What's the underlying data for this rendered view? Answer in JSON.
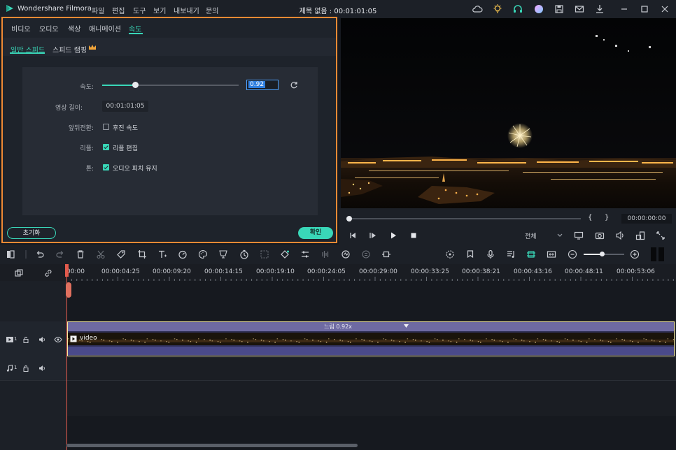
{
  "app": {
    "title": "Wondershare Filmora",
    "doc_title": "제목 없음 : 00:01:01:05"
  },
  "menu": [
    "파일",
    "편집",
    "도구",
    "보기",
    "내보내기",
    "문의"
  ],
  "panel": {
    "tabs": [
      "비디오",
      "오디오",
      "색상",
      "애니메이션",
      "속도"
    ],
    "active_tab": "속도",
    "subtabs": [
      "일반 스피드",
      "스피드 램핑"
    ],
    "speed_label": "속도:",
    "speed_value": "0.92",
    "speed_slider_fraction": 0.24,
    "duration_label": "영상 길이:",
    "duration_value": "00:01:01:05",
    "reverse_label": "앞뒤전환:",
    "reverse_text": "후진 속도",
    "reverse_checked": false,
    "ripple_label": "리플:",
    "ripple_text": "리플 편집",
    "ripple_checked": true,
    "tone_label": "톤:",
    "tone_text": "오디오 피치 유지",
    "tone_checked": true,
    "reset_label": "초기화",
    "ok_label": "확인"
  },
  "preview": {
    "timecode": "00:00:00:00",
    "quality": "전체",
    "brace_open": "{",
    "brace_close": "}"
  },
  "timeline": {
    "ruler": [
      "00:00",
      "00:00:04:25",
      "00:00:09:20",
      "00:00:14:15",
      "00:00:19:10",
      "00:00:24:05",
      "00:00:29:00",
      "00:00:33:25",
      "00:00:38:21",
      "00:00:43:16",
      "00:00:48:11",
      "00:00:53:06"
    ],
    "clip_name": "video",
    "clip_speed": "느림 0.92x",
    "video_track_num": "1",
    "audio_track_num": "1"
  },
  "colors": {
    "accent": "#39d7b8",
    "highlight": "#f08a34",
    "playhead": "#e25a4c"
  }
}
